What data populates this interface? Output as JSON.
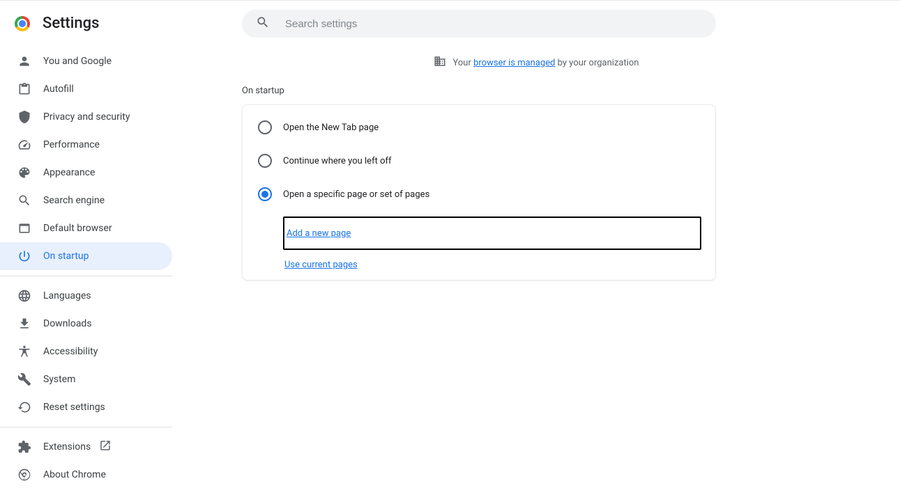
{
  "app": {
    "title": "Settings"
  },
  "search": {
    "placeholder": "Search settings"
  },
  "managed": {
    "prefix": "Your ",
    "link": "browser is managed",
    "suffix": " by your organization"
  },
  "sidebar": {
    "items": [
      {
        "label": "You and Google"
      },
      {
        "label": "Autofill"
      },
      {
        "label": "Privacy and security"
      },
      {
        "label": "Performance"
      },
      {
        "label": "Appearance"
      },
      {
        "label": "Search engine"
      },
      {
        "label": "Default browser"
      },
      {
        "label": "On startup"
      }
    ],
    "items2": [
      {
        "label": "Languages"
      },
      {
        "label": "Downloads"
      },
      {
        "label": "Accessibility"
      },
      {
        "label": "System"
      },
      {
        "label": "Reset settings"
      }
    ],
    "items3": [
      {
        "label": "Extensions"
      },
      {
        "label": "About Chrome"
      }
    ]
  },
  "startup": {
    "section_title": "On startup",
    "options": [
      {
        "label": "Open the New Tab page"
      },
      {
        "label": "Continue where you left off"
      },
      {
        "label": "Open a specific page or set of pages"
      }
    ],
    "add_new_page": "Add a new page",
    "use_current_pages": "Use current pages"
  }
}
